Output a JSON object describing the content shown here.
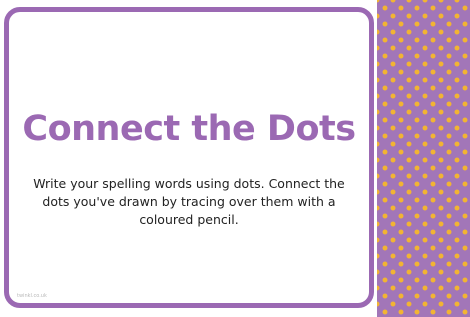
{
  "card": {
    "title": "Connect the Dots",
    "instructions": "Write your spelling words using dots. Connect the dots you've drawn by tracing over them with a coloured pencil.",
    "footer": "twinkl.co.uk"
  },
  "colors": {
    "border": "#9b69b3",
    "title": "#9b69b3",
    "panel_background": "#a276b8",
    "dots": "#f2b432"
  }
}
